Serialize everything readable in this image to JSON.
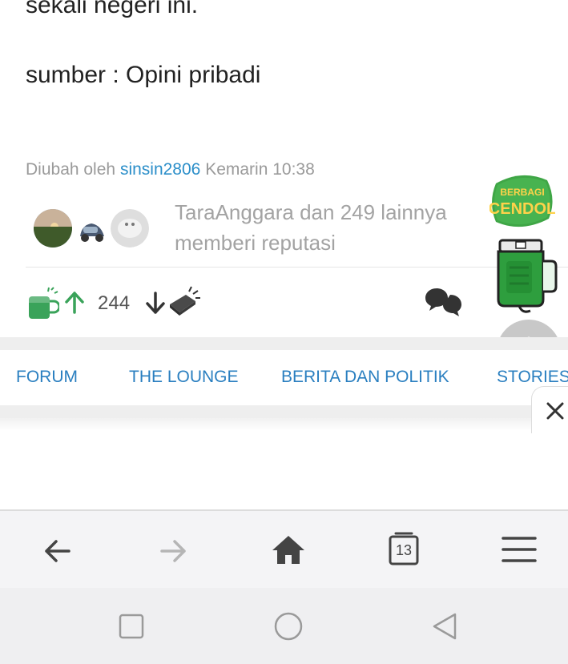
{
  "post": {
    "line_partial": "sekali negeri ini.",
    "source": "sumber : Opini pribadi"
  },
  "edit_info": {
    "prefix": "Diubah oleh",
    "username": "sinsin2806",
    "time": "Kemarin 10:38"
  },
  "reputation": {
    "text": "TaraAnggara dan 249 lainnya memberi reputasi"
  },
  "actions": {
    "vote_count": "244"
  },
  "cendol": {
    "badge_line1": "BERBAGI",
    "badge_line2": "CENDOL"
  },
  "tabs": [
    {
      "label": "FORUM"
    },
    {
      "label": "THE LOUNGE"
    },
    {
      "label": "BERITA DAN POLITIK"
    },
    {
      "label": "STORIES"
    }
  ],
  "browser": {
    "tab_count": "13"
  },
  "colors": {
    "link": "#2a8ec9",
    "tab": "#2a7fc0",
    "green": "#3aa35a",
    "cendol_green": "#2e9e3e"
  }
}
